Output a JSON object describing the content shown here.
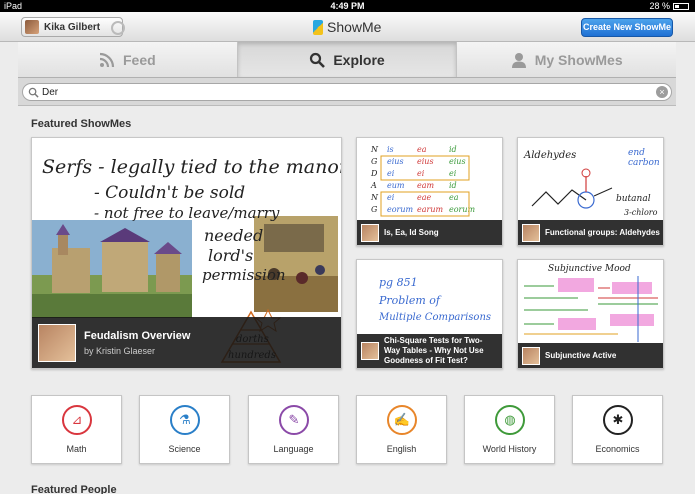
{
  "status_bar": {
    "device": "iPad",
    "time": "4:49 PM",
    "battery": "28 %"
  },
  "nav": {
    "user_name": "Kika Gilbert",
    "app_name": "ShowMe",
    "create_button": "Create New ShowMe"
  },
  "tabs": [
    {
      "label": "Feed",
      "icon": "rss-icon",
      "active": false
    },
    {
      "label": "Explore",
      "icon": "search-icon",
      "active": true
    },
    {
      "label": "My ShowMes",
      "icon": "person-icon",
      "active": false
    }
  ],
  "search": {
    "value": "Der"
  },
  "featured": {
    "title": "Featured ShowMes",
    "main": {
      "title": "Feudalism Overview",
      "author": "by Kristin Glaeser",
      "ink": [
        "Serfs - legally tied to the manor",
        "- Couldn't be sold",
        "- not free to leave/marry",
        "needed",
        "lord's",
        "permission",
        "dorths",
        "hundreds"
      ]
    },
    "cards": [
      {
        "title": "Is, Ea, Id Song"
      },
      {
        "title": "Functional groups: Aldehydes",
        "ink": [
          "Aldehydes",
          "end",
          "carbon",
          "butanal",
          "3-chloro"
        ]
      },
      {
        "title": "Chi-Square Tests for Two-Way Tables - Why Not Use Goodness of Fit Test?",
        "ink": [
          "pg 851",
          "Problem of",
          "Multiple Comparisons"
        ]
      },
      {
        "title": "Subjunctive Active",
        "ink": [
          "Subjunctive Mood"
        ]
      }
    ]
  },
  "categories": [
    {
      "label": "Math",
      "icon": "math-icon",
      "color": "#d9363e"
    },
    {
      "label": "Science",
      "icon": "flask-icon",
      "color": "#2a7fc8"
    },
    {
      "label": "Language",
      "icon": "language-icon",
      "color": "#8b4aa8"
    },
    {
      "label": "English",
      "icon": "english-icon",
      "color": "#e8862a"
    },
    {
      "label": "World History",
      "icon": "globe-icon",
      "color": "#3f9a3a"
    },
    {
      "label": "Economics",
      "icon": "economics-icon",
      "color": "#222222"
    }
  ],
  "featured_people": {
    "title": "Featured People"
  }
}
